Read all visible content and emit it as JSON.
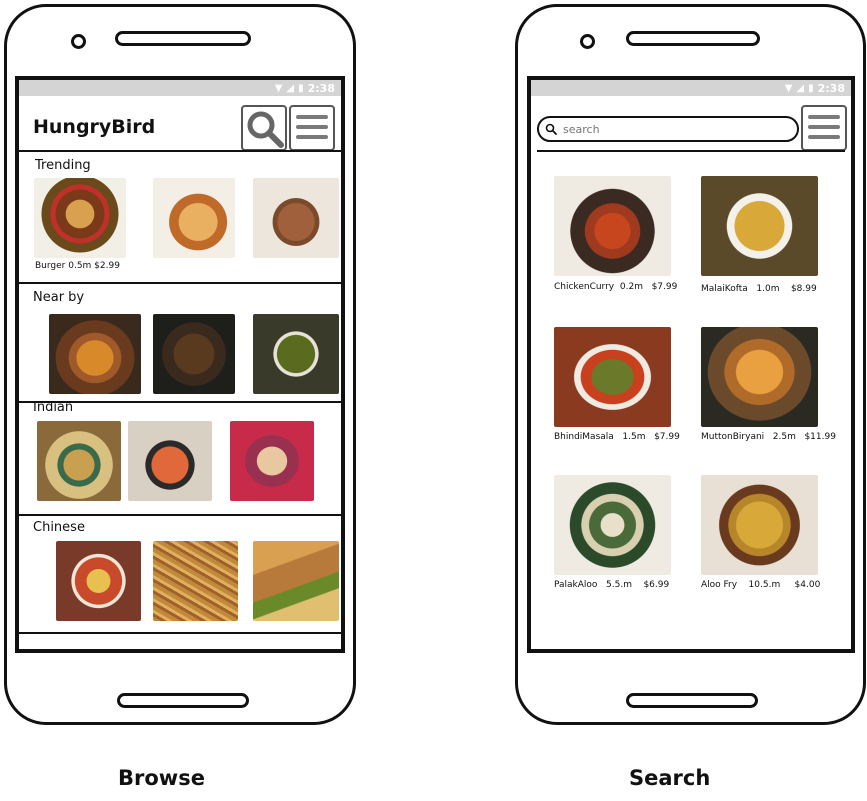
{
  "status_time": "2:38",
  "browse": {
    "app_title": "HungryBird",
    "search_icon": "magnifier-icon",
    "menu_icon": "hamburger-icon",
    "sections": [
      {
        "label": "Trending",
        "caption": "Burger 0.5m $2.99",
        "items": [
          {
            "name": "burger",
            "color": "#8a4a22"
          },
          {
            "name": "pizza",
            "color": "#d68a3a"
          },
          {
            "name": "steak",
            "color": "#a0603c"
          }
        ]
      },
      {
        "label": "Near by",
        "items": [
          {
            "name": "curry",
            "color": "#c47a2a"
          },
          {
            "name": "kofta-pan",
            "color": "#3a3a2a"
          },
          {
            "name": "palak-bowl",
            "color": "#5a6a1e"
          }
        ]
      },
      {
        "label": "Indian",
        "items": [
          {
            "name": "thali",
            "color": "#c9a050"
          },
          {
            "name": "tomato-soup",
            "color": "#d8582a"
          },
          {
            "name": "wraps",
            "color": "#9a3050"
          }
        ]
      },
      {
        "label": "Chinese",
        "items": [
          {
            "name": "stir-fry",
            "color": "#c84a2a"
          },
          {
            "name": "noodles",
            "color": "#c08a3a"
          },
          {
            "name": "spring-rolls",
            "color": "#b87a3a"
          }
        ]
      }
    ],
    "caption": "Browse"
  },
  "search": {
    "placeholder": "search",
    "menu_icon": "hamburger-icon",
    "results": [
      {
        "name": "ChickenCurry",
        "dist": "0.2m",
        "price": "$7.99",
        "color": "#a03a1e"
      },
      {
        "name": "MalaiKofta",
        "dist": "1.0m",
        "price": "$8.99",
        "color": "#d8a838"
      },
      {
        "name": "BhindiMasala",
        "dist": "1.5m",
        "price": "$7.99",
        "color": "#6a7a2a"
      },
      {
        "name": "MuttonBiryani",
        "dist": "2.5m",
        "price": "$11.99",
        "color": "#b06a2a"
      },
      {
        "name": "PalakAloo",
        "dist": "5.5.m",
        "price": "$6.99",
        "color": "#4a6a3a"
      },
      {
        "name": "Aloo Fry",
        "dist": "10.5.m",
        "price": "$4.00",
        "color": "#b8862a"
      }
    ],
    "caption": "Search"
  }
}
